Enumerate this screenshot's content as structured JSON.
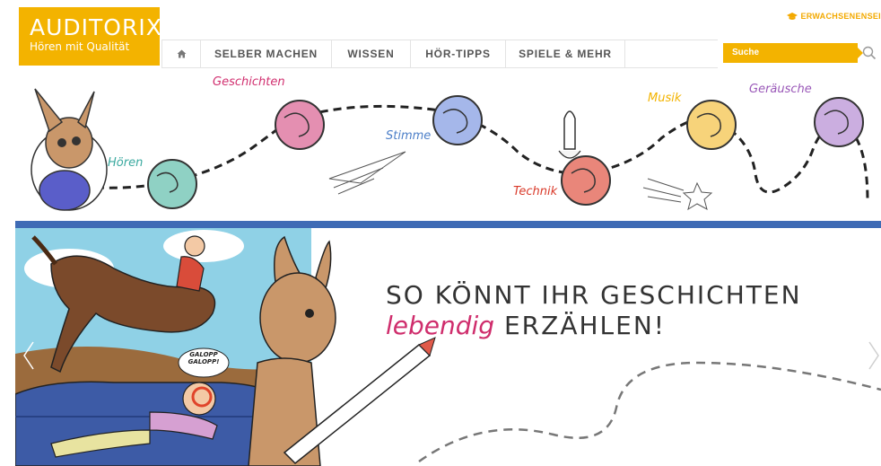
{
  "logo": {
    "name": "AUDITORIX",
    "tagline": "Hören mit Qualität"
  },
  "topbar": {
    "adult_link": "ERWACHSENENSEI"
  },
  "nav": {
    "items": [
      {
        "label": "SELBER MACHEN"
      },
      {
        "label": "WISSEN"
      },
      {
        "label": "HÖR-TIPPS"
      },
      {
        "label": "SPIELE & MEHR"
      }
    ]
  },
  "search": {
    "placeholder": "Suche"
  },
  "band": {
    "planets": [
      {
        "label": "Hören",
        "color": "#3aa99f"
      },
      {
        "label": "Geschichten",
        "color": "#d12f6f"
      },
      {
        "label": "Stimme",
        "color": "#4c7fc8"
      },
      {
        "label": "Technik",
        "color": "#d93a2a"
      },
      {
        "label": "Musik",
        "color": "#f3b300"
      },
      {
        "label": "Geräusche",
        "color": "#9a58b8"
      }
    ]
  },
  "slide": {
    "headline_line1": "SO KÖNNT IHR GESCHICHTEN",
    "headline_accent": "lebendig",
    "headline_rest": "ERZÄHLEN!",
    "speech": "GALOPP GALOPP!"
  },
  "colors": {
    "brand": "#f3b300",
    "divider": "#3f6bb5",
    "accent": "#cf2d6c"
  }
}
